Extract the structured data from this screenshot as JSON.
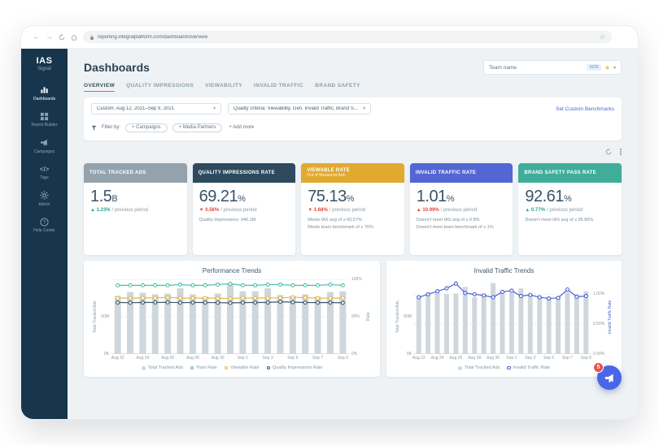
{
  "browser": {
    "url": "reporting.integralplatform.com/dashboard/overview"
  },
  "sidebar": {
    "logo": {
      "line1": "IAS",
      "line2": "Signal"
    },
    "items": [
      {
        "label": "Dashboards",
        "icon": "bar-chart-icon",
        "active": true
      },
      {
        "label": "Report Builder",
        "icon": "grid-icon",
        "active": false
      },
      {
        "label": "Campaigns",
        "icon": "megaphone-icon",
        "active": false
      },
      {
        "label": "Tags",
        "icon": "code-icon",
        "active": false
      },
      {
        "label": "Admin",
        "icon": "gear-icon",
        "active": false
      },
      {
        "label": "Help Center",
        "icon": "help-icon",
        "active": false
      }
    ]
  },
  "header": {
    "title": "Dashboards",
    "team": {
      "label": "Team name",
      "badge": "SOS"
    }
  },
  "tabs": [
    {
      "label": "OVERVIEW",
      "active": true
    },
    {
      "label": "QUALITY IMPRESSIONS",
      "active": false
    },
    {
      "label": "VIEWABILITY",
      "active": false
    },
    {
      "label": "INVALID TRAFFIC",
      "active": false
    },
    {
      "label": "BRAND SAFETY",
      "active": false
    }
  ],
  "filters": {
    "date_range": "Custom: Aug 12, 2021–Sep 9, 2021",
    "quality_criteria": "Quality criteria: Viewability, Gen. Invalid Traffic, Brand S...",
    "benchmarks_link": "Set Custom Benchmarks",
    "filter_by_label": "Filter by:",
    "pills": [
      "+ Campaigns",
      "+ Media Partners"
    ],
    "add_more": "+ Add more"
  },
  "toolbar": {
    "icons": [
      "refresh-icon",
      "more-icon"
    ]
  },
  "colors": {
    "sidebar_bg": "#17364d",
    "tab_accent": "#e8624d",
    "link_blue": "#4a67d6",
    "positive": "#21a78d",
    "negative": "#e0483e",
    "bar_gray": "#cfd7dd"
  },
  "kpis": [
    {
      "title": "TOTAL TRACKED ADS",
      "header_color": "#94a2ad",
      "value": "1.5",
      "unit": "B",
      "change": {
        "text": "▲ 1.23%",
        "color": "#21a78d",
        "suffix": "/ previous period"
      },
      "notes": []
    },
    {
      "title": "QUALITY IMPRESSIONS RATE",
      "header_color": "#2e4a5e",
      "value": "69.21",
      "unit": "%",
      "change": {
        "text": "▼ 0.56%",
        "color": "#e0483e",
        "suffix": "/ previous period"
      },
      "notes": [
        "Quality Impressions: 946.1M"
      ]
    },
    {
      "title": "VIEWABLE RATE",
      "subtitle": "Out of Measured Ads",
      "header_color": "#e1aa2f",
      "value": "75.13",
      "unit": "%",
      "change": {
        "text": "▼ 1.68%",
        "color": "#e0483e",
        "suffix": "/ previous period"
      },
      "notes": [
        "Meets IAS avg of ≥ 60.57%",
        "Meets team benchmark of ≥ 70%"
      ]
    },
    {
      "title": "INVALID TRAFFIC RATE",
      "header_color": "#5366d3",
      "value": "1.01",
      "unit": "%",
      "change": {
        "text": "▲ 10.99%",
        "color": "#e0483e",
        "suffix": "/ previous period"
      },
      "notes": [
        "Doesn't meet IAS avg of ≤ 0.8%",
        "Doesn't meet team benchmark of ≤ 1%"
      ]
    },
    {
      "title": "BRAND SAFETY PASS RATE",
      "header_color": "#3fad99",
      "value": "92.61",
      "unit": "%",
      "change": {
        "text": "▲ 0.77%",
        "color": "#21a78d",
        "suffix": "/ previous period"
      },
      "notes": [
        "Doesn't meet IAS avg of ≥ 95.89%"
      ]
    }
  ],
  "chart_data": [
    {
      "type": "bar+line",
      "title": "Performance Trends",
      "categories": [
        "Aug 22",
        "Aug 23",
        "Aug 24",
        "Aug 25",
        "Aug 26",
        "Aug 27",
        "Aug 28",
        "Aug 29",
        "Aug 30",
        "Aug 31",
        "Sep 1",
        "Sep 2",
        "Sep 3",
        "Sep 4",
        "Sep 5",
        "Sep 6",
        "Sep 7",
        "Sep 8",
        "Sep 9"
      ],
      "x_tick_labels": [
        "Aug 22",
        "Aug 24",
        "Aug 26",
        "Aug 28",
        "Aug 30",
        "Sep 1",
        "Sep 3",
        "Sep 5",
        "Sep 7",
        "Sep 9"
      ],
      "x_tick_step": 2,
      "bars": {
        "name": "Total Tracked Ads",
        "color": "#cfd7dd",
        "unit": "M",
        "values": [
          78,
          83,
          82,
          80,
          81,
          88,
          80,
          77,
          81,
          93,
          84,
          84,
          88,
          79,
          78,
          80,
          77,
          83,
          84
        ]
      },
      "series": [
        {
          "name": "Pass Rate",
          "color": "#4cbfa9",
          "values": [
            92,
            92,
            92,
            92,
            92,
            93,
            92,
            92,
            93,
            94,
            92,
            92,
            93,
            93,
            92,
            92,
            92,
            93,
            92
          ]
        },
        {
          "name": "Viewable Rate",
          "color": "#e8b93f",
          "values": [
            75,
            75,
            75.3,
            75.2,
            75.8,
            75.1,
            74.9,
            75,
            74.7,
            74.5,
            75,
            75.1,
            75,
            75.2,
            76,
            75.6,
            74.8,
            75,
            75
          ]
        },
        {
          "name": "Quality Impressions Rate",
          "color": "#3a576e",
          "values": [
            69,
            68.8,
            69,
            69.1,
            69.2,
            68.8,
            69,
            69,
            68.8,
            68.5,
            68.9,
            69,
            69,
            70,
            69.4,
            69,
            68.9,
            69,
            68.6
          ]
        }
      ],
      "left_axis": {
        "label": "Total Tracked Ads",
        "max": 100,
        "ticks": [
          {
            "v": 50,
            "label": "50M"
          },
          {
            "v": 0,
            "label": "0K"
          }
        ]
      },
      "right_axis": {
        "label": "Rate",
        "max": 100,
        "ticks": [
          {
            "v": 100,
            "label": "100%"
          },
          {
            "v": 50,
            "label": "50%"
          },
          {
            "v": 0,
            "label": "0%"
          }
        ]
      },
      "legend_position": "bottom",
      "legend": [
        {
          "label": "Total Tracked Ads",
          "marker": "bar",
          "color": "#cfd7dd"
        },
        {
          "label": "Pass Rate",
          "marker": "line",
          "color": "#4cbfa9"
        },
        {
          "label": "Viewable Rate",
          "marker": "line",
          "color": "#e8b93f"
        },
        {
          "label": "Quality Impressions Rate",
          "marker": "line",
          "color": "#3a576e"
        }
      ]
    },
    {
      "type": "bar+line",
      "title": "Invalid Traffic Trends",
      "categories": [
        "Aug 22",
        "Aug 23",
        "Aug 24",
        "Aug 25",
        "Aug 26",
        "Aug 27",
        "Aug 28",
        "Aug 29",
        "Aug 30",
        "Aug 31",
        "Sep 1",
        "Sep 2",
        "Sep 3",
        "Sep 4",
        "Sep 5",
        "Sep 6",
        "Sep 7",
        "Sep 8",
        "Sep 9"
      ],
      "x_tick_labels": [
        "Aug 22",
        "Aug 24",
        "Aug 26",
        "Aug 28",
        "Aug 30",
        "Sep 1",
        "Sep 3",
        "Sep 5",
        "Sep 7",
        "Sep 9"
      ],
      "x_tick_step": 2,
      "bars": {
        "name": "Total Tracked Ads",
        "color": "#cfd7dd",
        "unit": "M",
        "values": [
          78,
          82,
          84,
          80,
          81,
          90,
          76,
          81,
          95,
          83,
          82,
          88,
          80,
          78,
          76,
          77,
          83,
          79,
          84
        ]
      },
      "series": [
        {
          "name": "Invalid Traffic Rate",
          "color": "#4d63cf",
          "values": [
            0.95,
            1.0,
            1.05,
            1.1,
            1.18,
            1.02,
            1.0,
            0.98,
            0.95,
            1.04,
            1.06,
            0.97,
            0.99,
            0.95,
            0.93,
            0.94,
            1.08,
            0.96,
            0.97
          ]
        }
      ],
      "left_axis": {
        "label": "Total Tracked Ads",
        "max": 100,
        "ticks": [
          {
            "v": 50,
            "label": "50M"
          },
          {
            "v": 0,
            "label": "0K"
          }
        ]
      },
      "right_axis": {
        "label": "Invalid Traffic Rate",
        "max": 1.25,
        "ticks": [
          {
            "v": 1.0,
            "label": "1.00%"
          },
          {
            "v": 0.5,
            "label": "0.50%"
          },
          {
            "v": 0,
            "label": "0.00%"
          }
        ]
      },
      "legend_position": "bottom",
      "legend": [
        {
          "label": "Total Tracked Ads",
          "marker": "bar",
          "color": "#cfd7dd"
        },
        {
          "label": "Invalid Traffic Rate",
          "marker": "line",
          "color": "#4d63cf"
        }
      ]
    }
  ],
  "chat": {
    "badge": "5"
  }
}
